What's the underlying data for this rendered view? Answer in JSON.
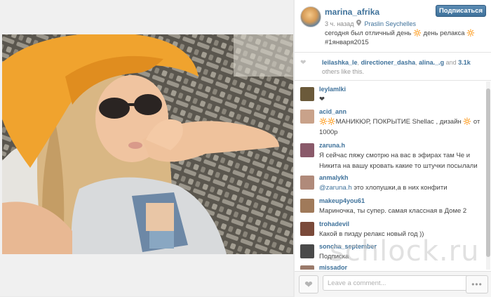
{
  "post": {
    "username": "marina_afrika",
    "follow_label": "Подписаться",
    "time_ago": "3 ч. назад",
    "location_icon": "location-pin-icon",
    "location": "Praslin Seychelles",
    "caption": "сегодня был отличный день 🔆 день релакса 🔆 #1января2015"
  },
  "likes": {
    "heart_icon": "heart-icon",
    "user1": "leilashka_le",
    "user2": "directioner_dasha",
    "user3": "alina._.g",
    "and_word": "and",
    "count": "3.1k",
    "suffix": "others like this."
  },
  "comments": [
    {
      "user": "leylamlki",
      "text": "❤"
    },
    {
      "user": "acid_ann",
      "text": "🔆🔆МАНИКЮР, ПОКРЫТИЕ Shellac , дизайн 🔆 от 1000р"
    },
    {
      "user": "zaruna.h",
      "text": "Я сейчас пяжу смотрю на вас в эфирах там Че и Никита на вашу кровать какие то штучки посылали"
    },
    {
      "user": "anmalykh",
      "mention": "@zaruna.h",
      "text": "это хлопушки,а в них конфити"
    },
    {
      "user": "makeup4you61",
      "text": "Мариночка, ты супер. самая классная в Доме 2"
    },
    {
      "user": "trohadevil",
      "text": "Какой в пизду релакс новый год ))"
    },
    {
      "user": "soncha_september",
      "text": "Подписка"
    },
    {
      "user": "missador",
      "text": ""
    }
  ],
  "footer": {
    "comment_placeholder": "Leave a comment...",
    "more_label": "•••"
  },
  "watermark": "schlock.ru",
  "colors": {
    "link": "#3f729b",
    "follow_button": "#3f729b",
    "text": "#444444",
    "muted": "#8a8a8a"
  }
}
